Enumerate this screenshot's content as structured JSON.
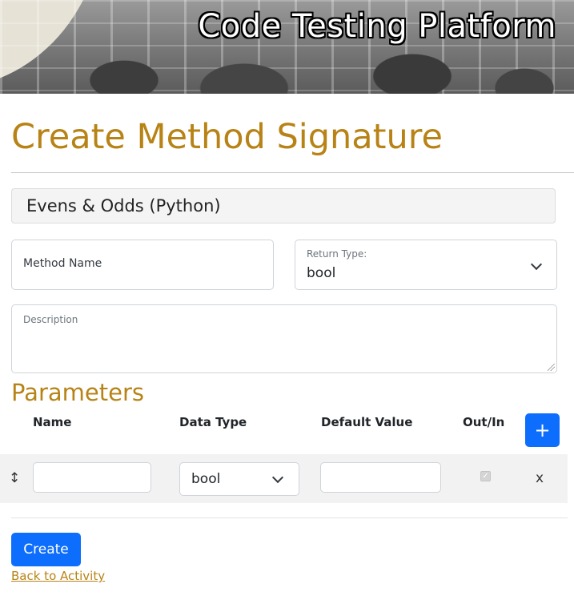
{
  "banner": {
    "title": "Code Testing Platform"
  },
  "page": {
    "title": "Create Method Signature"
  },
  "activity": {
    "name": "Evens & Odds (Python)"
  },
  "form": {
    "method_name_placeholder": "Method Name",
    "return_type_label": "Return Type:",
    "return_type_value": "bool",
    "description_label": "Description"
  },
  "parameters": {
    "title": "Parameters",
    "headers": [
      "Name",
      "Data Type",
      "Default Value",
      "Out/In"
    ],
    "add_label": "+",
    "rows": [
      {
        "drag": "↕",
        "name": "",
        "data_type": "bool",
        "default_value": "",
        "out_in": true,
        "remove": "x"
      }
    ]
  },
  "actions": {
    "create_label": "Create",
    "back_label": "Back to Activity"
  },
  "colors": {
    "accent": "#b88316",
    "primary": "#0d6efd"
  }
}
